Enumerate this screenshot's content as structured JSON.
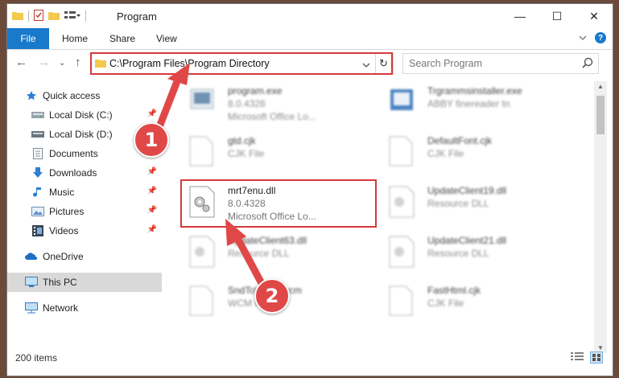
{
  "window": {
    "title": "Program",
    "controls": {
      "minimize": "—",
      "maximize": "☐",
      "close": "✕"
    }
  },
  "ribbon": {
    "tabs": [
      "File",
      "Home",
      "Share",
      "View"
    ],
    "expand_icon": "chevron-down",
    "help_label": "?"
  },
  "navigation": {
    "path": "C:\\Program Files\\Program Directory",
    "search_placeholder": "Search Program"
  },
  "sidebar": {
    "items": [
      {
        "label": "Quick access",
        "icon": "star-icon"
      },
      {
        "label": "Local Disk (C:)",
        "icon": "drive-icon",
        "pinned": true
      },
      {
        "label": "Local Disk (D:)",
        "icon": "drive-icon",
        "pinned": true
      },
      {
        "label": "Documents",
        "icon": "documents-icon",
        "pinned": true
      },
      {
        "label": "Downloads",
        "icon": "download-icon",
        "pinned": true
      },
      {
        "label": "Music",
        "icon": "music-icon",
        "pinned": true
      },
      {
        "label": "Pictures",
        "icon": "pictures-icon",
        "pinned": true
      },
      {
        "label": "Videos",
        "icon": "videos-icon",
        "pinned": true
      },
      {
        "label": "OneDrive",
        "icon": "cloud-icon"
      },
      {
        "label": "This PC",
        "icon": "pc-icon",
        "selected": true
      },
      {
        "label": "Network",
        "icon": "network-icon"
      }
    ]
  },
  "files": [
    {
      "name": "program.exe",
      "line2": "8.0.4328",
      "line3": "Microsoft Office Lo..."
    },
    {
      "name": "Trgrammsinstaller.exe",
      "line2": "ABBY finereader tn",
      "line3": ""
    },
    {
      "name": "gtd.cjk",
      "line2": "CJK File",
      "line3": ""
    },
    {
      "name": "DefaultFont.cjk",
      "line2": "CJK File",
      "line3": ""
    },
    {
      "name": "mrt7enu.dll",
      "line2": "8.0.4328",
      "line3": "Microsoft Office Lo..."
    },
    {
      "name": "UpdateClient19.dll",
      "line2": "Resource DLL",
      "line3": ""
    },
    {
      "name": "UpdateClient63.dll",
      "line2": "Resource DLL",
      "line3": ""
    },
    {
      "name": "UpdateClient21.dll",
      "line2": "Resource DLL",
      "line3": ""
    },
    {
      "name": "SndToWCM.wcm",
      "line2": "WCM File",
      "line3": ""
    },
    {
      "name": "FastHtml.cjk",
      "line2": "CJK File",
      "line3": ""
    }
  ],
  "status": {
    "item_count": "200 items"
  },
  "annotations": {
    "step1": "1",
    "step2": "2"
  },
  "colors": {
    "accent": "#1979ca",
    "highlight": "#d6393b",
    "badge": "#e04848"
  }
}
